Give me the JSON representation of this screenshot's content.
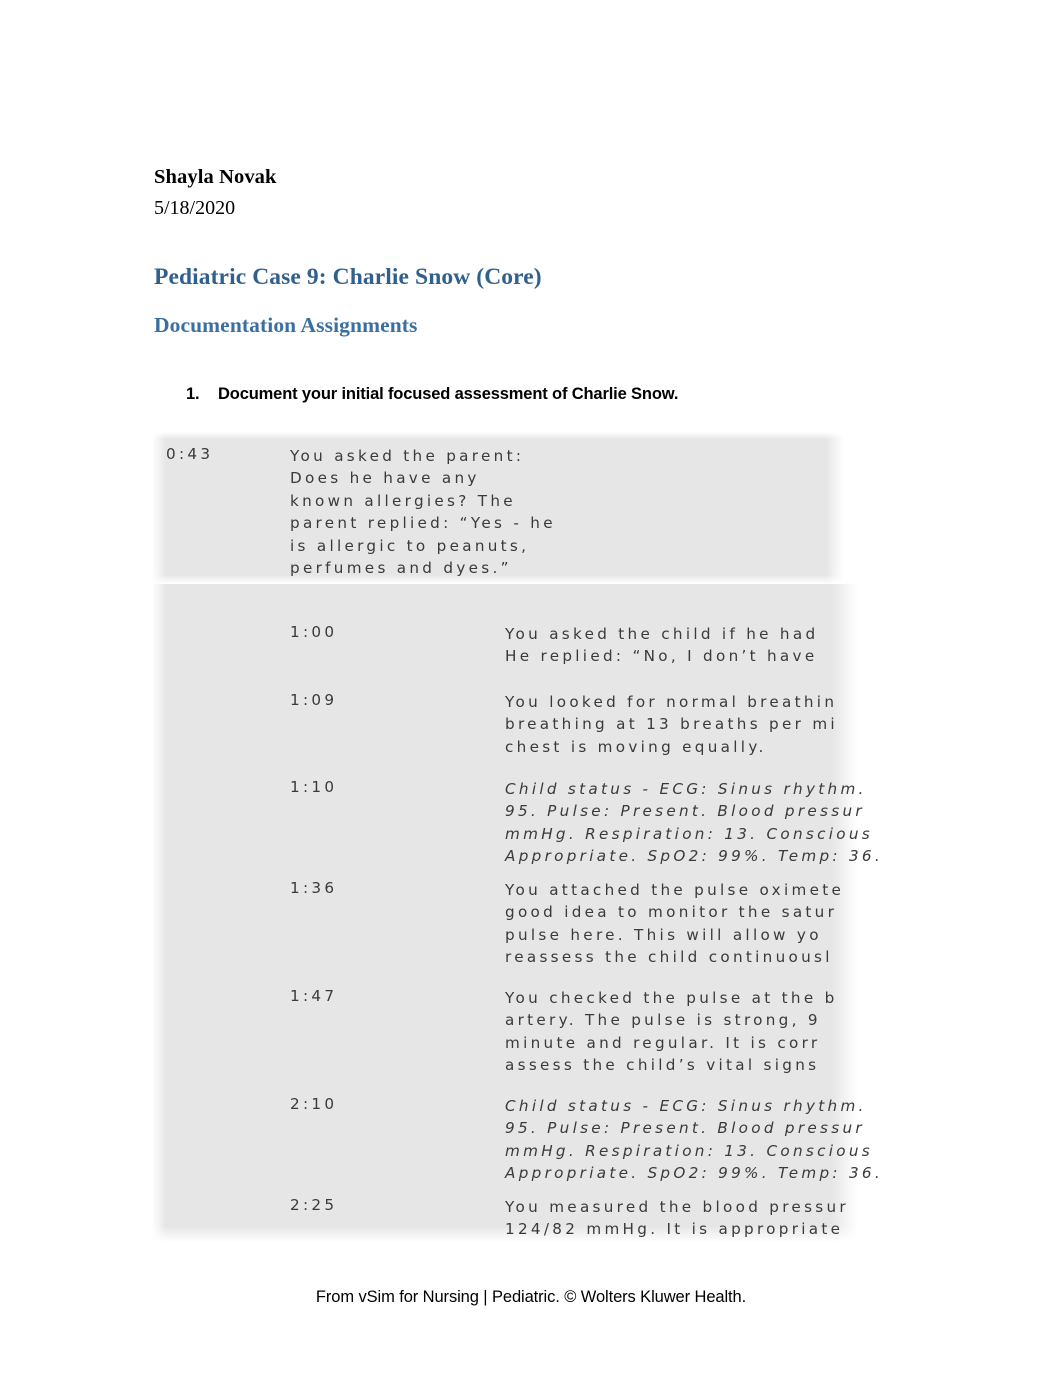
{
  "document": {
    "author": "Shayla Novak",
    "date": "5/18/2020",
    "title": "Pediatric Case 9: Charlie Snow (Core)",
    "subtitle": "Documentation Assignments",
    "footer": "From vSim for Nursing | Pediatric. © Wolters Kluwer Health.",
    "accent_color": "#31608D",
    "subtitle_color": "#3B6FA0",
    "log_background_color": "#E6E6E6",
    "log_text_color": "#3A3A3A"
  },
  "assignments": [
    {
      "number": "1.",
      "text": "Document your initial focused assessment of Charlie Snow."
    }
  ],
  "log": {
    "entries": [
      {
        "time": "0:43",
        "style": "normal",
        "lines": [
          "You asked the parent:",
          "Does he have any",
          "known allergies? The",
          "parent replied: “Yes - he",
          "is allergic to peanuts,",
          "perfumes and dyes.”"
        ]
      },
      {
        "time": "1:00",
        "style": "normal",
        "lines": [
          "You asked the child if he had",
          "He replied: “No, I don’t have"
        ]
      },
      {
        "time": "1:09",
        "style": "normal",
        "lines": [
          "You looked for normal breathin",
          "breathing at 13 breaths per mi",
          "chest is moving equally."
        ]
      },
      {
        "time": "1:10",
        "style": "italic",
        "lines": [
          "Child status - ECG: Sinus rhythm.",
          "95. Pulse: Present. Blood pressur",
          "mmHg. Respiration: 13. Conscious",
          "Appropriate. SpO2: 99%. Temp: 36."
        ]
      },
      {
        "time": "1:36",
        "style": "normal",
        "lines": [
          "You attached the pulse oximete",
          "good idea to monitor the satur",
          "pulse here. This will allow yo",
          "reassess the child continuousl"
        ]
      },
      {
        "time": "1:47",
        "style": "normal",
        "lines": [
          "You checked the pulse at the b",
          "artery. The pulse is strong, 9",
          "minute and regular. It is corr",
          "assess the child’s vital signs"
        ]
      },
      {
        "time": "2:10",
        "style": "italic",
        "lines": [
          "Child status - ECG: Sinus rhythm.",
          "95. Pulse: Present. Blood pressur",
          "mmHg. Respiration: 13. Conscious",
          "Appropriate. SpO2: 99%. Temp: 36."
        ]
      },
      {
        "time": "2:25",
        "style": "normal",
        "lines": [
          "You measured the blood pressur",
          "124/82 mmHg. It is appropriate"
        ]
      }
    ]
  }
}
